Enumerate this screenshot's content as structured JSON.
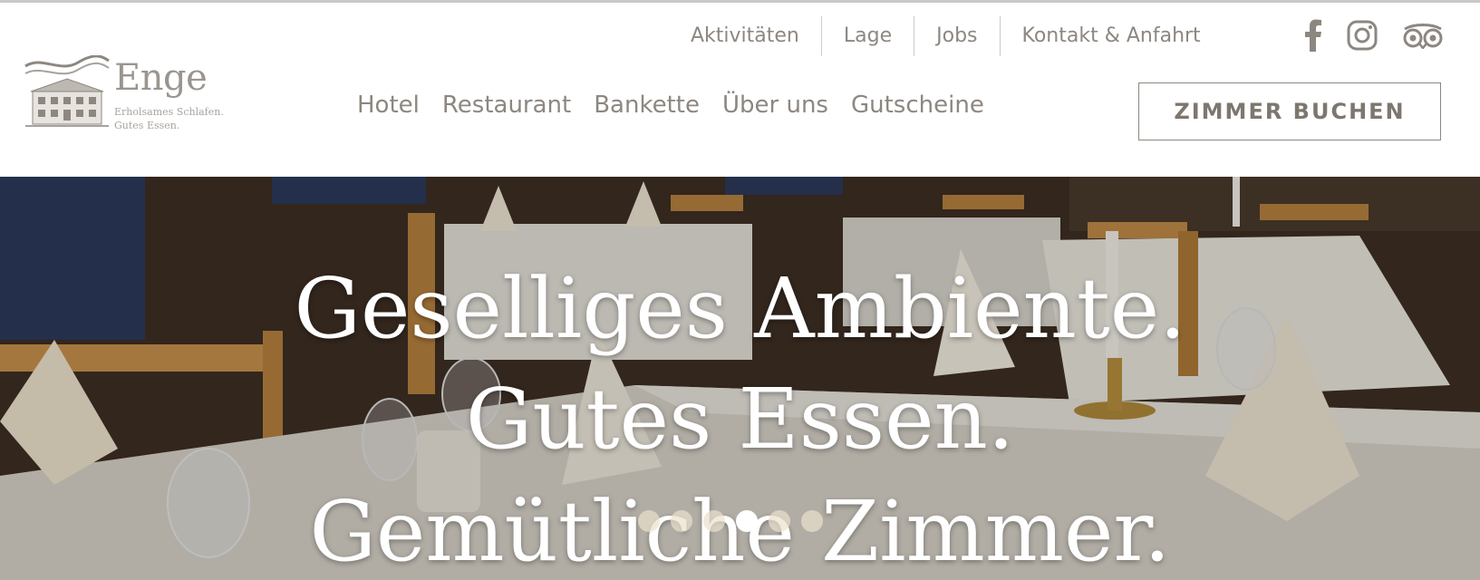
{
  "logo": {
    "name": "Enge",
    "tagline1": "Erholsames Schlafen.",
    "tagline2": "Gutes Essen."
  },
  "util_nav": [
    {
      "label": "Aktivitäten"
    },
    {
      "label": "Lage"
    },
    {
      "label": "Jobs"
    },
    {
      "label": "Kontakt & Anfahrt"
    }
  ],
  "social": [
    "facebook-icon",
    "instagram-icon",
    "tripadvisor-icon"
  ],
  "main_nav": [
    {
      "label": "Hotel"
    },
    {
      "label": "Restaurant"
    },
    {
      "label": "Bankette"
    },
    {
      "label": "Über uns"
    },
    {
      "label": "Gutscheine"
    }
  ],
  "book_button": "ZIMMER BUCHEN",
  "hero": {
    "line1": "Geselliges Ambiente.",
    "line2": "Gutes Essen.",
    "line3": "Gemütliche Zimmer.",
    "slide_count": 6,
    "active_slide": 4
  },
  "colors": {
    "nav_text": "#8d8780",
    "button_border": "#8d8780",
    "hero_text": "#ffffff"
  }
}
